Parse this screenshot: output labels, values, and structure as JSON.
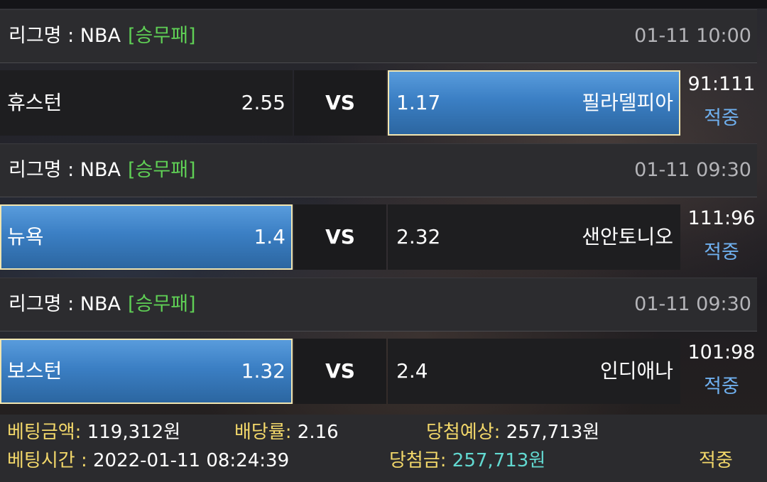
{
  "matches": [
    {
      "league": {
        "label": "리그명 : NBA",
        "type": "[승무패]",
        "datetime": "01-11 10:00"
      },
      "home": {
        "team": "휴스턴",
        "odds": "2.55"
      },
      "vs": "VS",
      "away": {
        "team": "필라델피아",
        "odds": "1.17"
      },
      "score": "91:111",
      "result": "적중",
      "selected": "away"
    },
    {
      "league": {
        "label": "리그명 : NBA",
        "type": "[승무패]",
        "datetime": "01-11 09:30"
      },
      "home": {
        "team": "뉴욕",
        "odds": "1.4"
      },
      "vs": "VS",
      "away": {
        "team": "샌안토니오",
        "odds": "2.32"
      },
      "score": "111:96",
      "result": "적중",
      "selected": "home"
    },
    {
      "league": {
        "label": "리그명 : NBA",
        "type": "[승무패]",
        "datetime": "01-11 09:30"
      },
      "home": {
        "team": "보스턴",
        "odds": "1.32"
      },
      "vs": "VS",
      "away": {
        "team": "인디애나",
        "odds": "2.4"
      },
      "score": "101:98",
      "result": "적중",
      "selected": "home"
    }
  ],
  "summary": {
    "bet_amount_label": "베팅금액:",
    "bet_amount": "119,312원",
    "odds_label": "배당률:",
    "odds": "2.16",
    "expected_label": "당첨예상:",
    "expected": "257,713원",
    "bet_time_label": "베팅시간 :",
    "bet_time": "2022-01-11 08:24:39",
    "win_label": "당첨금:",
    "win_amount": "257,713원",
    "status": "적중"
  },
  "colors": {
    "league_type": "#5fcf55",
    "result_text": "#6fb0ef",
    "summary_label": "#f3d86a",
    "win_amount": "#62d8d0",
    "selected_bg": "#3b7fc4"
  }
}
